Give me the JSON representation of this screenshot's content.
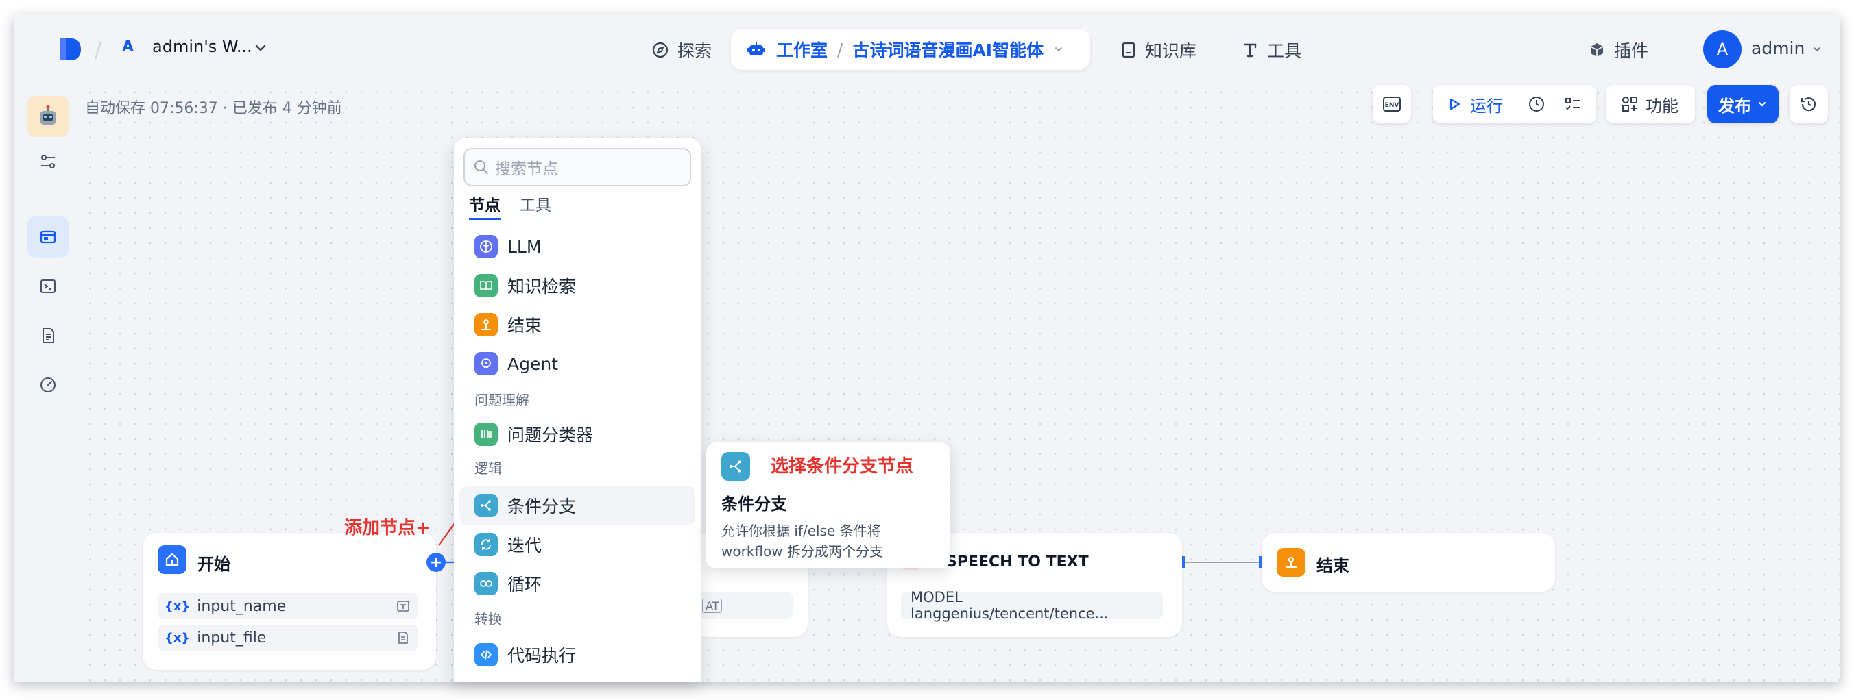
{
  "header": {
    "workspace_letter": "A",
    "workspace_name": "admin's W...",
    "nav": {
      "explore": "探索",
      "studio": "工作室",
      "app_name": "古诗词语音漫画AI智能体",
      "knowledge": "知识库",
      "tools": "工具",
      "plugins": "插件"
    },
    "user": {
      "avatar_letter": "A",
      "name": "admin"
    }
  },
  "toolbar": {
    "autosave": "自动保存 07:56:37 · 已发布 4 分钟前",
    "env": "ENV",
    "run": "运行",
    "features": "功能",
    "publish": "发布"
  },
  "nodes": {
    "start": {
      "title": "开始",
      "vars": [
        {
          "name": "input_name"
        },
        {
          "name": "input_file"
        }
      ]
    },
    "hidden_chip": "AT",
    "speech": {
      "title": "SPEECH TO TEXT",
      "model": "MODEL  langgenius/tencent/tence..."
    },
    "end": {
      "title": "结束"
    }
  },
  "popup": {
    "search_placeholder": "搜索节点",
    "tabs": [
      "节点",
      "工具"
    ],
    "items_top": [
      "LLM",
      "知识检索",
      "结束",
      "Agent"
    ],
    "group_question": "问题理解",
    "item_classifier": "问题分类器",
    "group_logic": "逻辑",
    "items_logic": [
      "条件分支",
      "迭代",
      "循环"
    ],
    "group_transform": "转换",
    "item_code": "代码执行"
  },
  "tooltip": {
    "title": "条件分支",
    "description": "允许你根据 if/else 条件将 workflow 拆分成两个分支"
  },
  "annotations": {
    "select_branch": "选择条件分支节点",
    "add_node": "添加节点+"
  },
  "colors": {
    "primary": "#155aef",
    "annotation": "#e5322d",
    "llm_icon": "#6172f3",
    "knowledge_icon": "#47b27b",
    "end_icon": "#f79009",
    "logic_icon": "#3ea6cf",
    "code_icon": "#2e90fa"
  }
}
